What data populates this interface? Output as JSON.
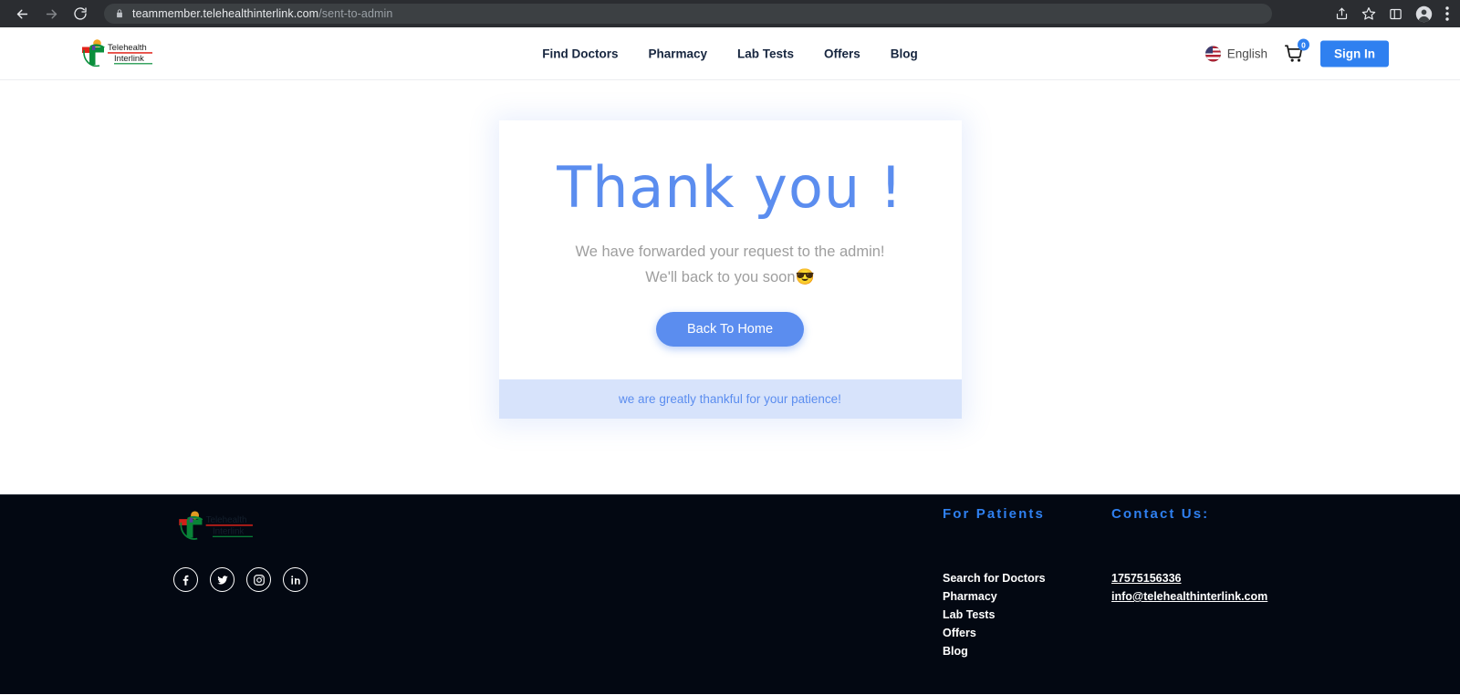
{
  "browser": {
    "back_icon": "back-arrow-icon",
    "forward_icon": "forward-arrow-icon",
    "reload_icon": "reload-icon",
    "lock_icon": "lock-icon",
    "url_domain": "teammember.telehealthinterlink.com",
    "url_path": "/sent-to-admin",
    "actions": [
      {
        "icon": "share-icon"
      },
      {
        "icon": "bookmark-star-icon"
      },
      {
        "icon": "side-panel-icon"
      },
      {
        "icon": "profile-avatar-icon"
      },
      {
        "icon": "three-dot-menu-icon"
      }
    ]
  },
  "header": {
    "logo": {
      "icon": "telehealth-interlink-logo",
      "line1": "Telehealth",
      "line2": "Interlink"
    },
    "nav": [
      {
        "label": "Find Doctors"
      },
      {
        "label": "Pharmacy"
      },
      {
        "label": "Lab Tests"
      },
      {
        "label": "Offers"
      },
      {
        "label": "Blog"
      }
    ],
    "language": {
      "icon": "us-flag-icon",
      "label": "English"
    },
    "cart": {
      "icon": "shopping-cart-icon",
      "count": "0"
    },
    "sign_in_label": "Sign In"
  },
  "main": {
    "title": "Thank you !",
    "message_line1": "We have forwarded your request to the admin!",
    "message_line2": "We'll back to you soon",
    "message_emoji": "😎",
    "button_label": "Back To Home",
    "footnote": "we are greatly thankful for your patience!"
  },
  "footer": {
    "logo": {
      "icon": "telehealth-interlink-logo",
      "line1": "Telehealth",
      "line2": "Interlink"
    },
    "socials": [
      {
        "icon": "facebook-icon"
      },
      {
        "icon": "twitter-icon"
      },
      {
        "icon": "instagram-icon"
      },
      {
        "icon": "linkedin-icon"
      }
    ],
    "patients": {
      "heading": "For Patients",
      "links": [
        {
          "label": "Search for Doctors"
        },
        {
          "label": "Pharmacy"
        },
        {
          "label": "Lab Tests"
        },
        {
          "label": "Offers"
        },
        {
          "label": "Blog"
        }
      ]
    },
    "contact": {
      "heading": "Contact Us:",
      "links": [
        {
          "label": "17575156336"
        },
        {
          "label": "info@telehealthinterlink.com"
        }
      ]
    }
  },
  "colors": {
    "accent_blue": "#2f80f0",
    "soft_blue": "#5b8def",
    "footnote_bg": "#d7e3fb",
    "footer_bg": "#030812"
  }
}
